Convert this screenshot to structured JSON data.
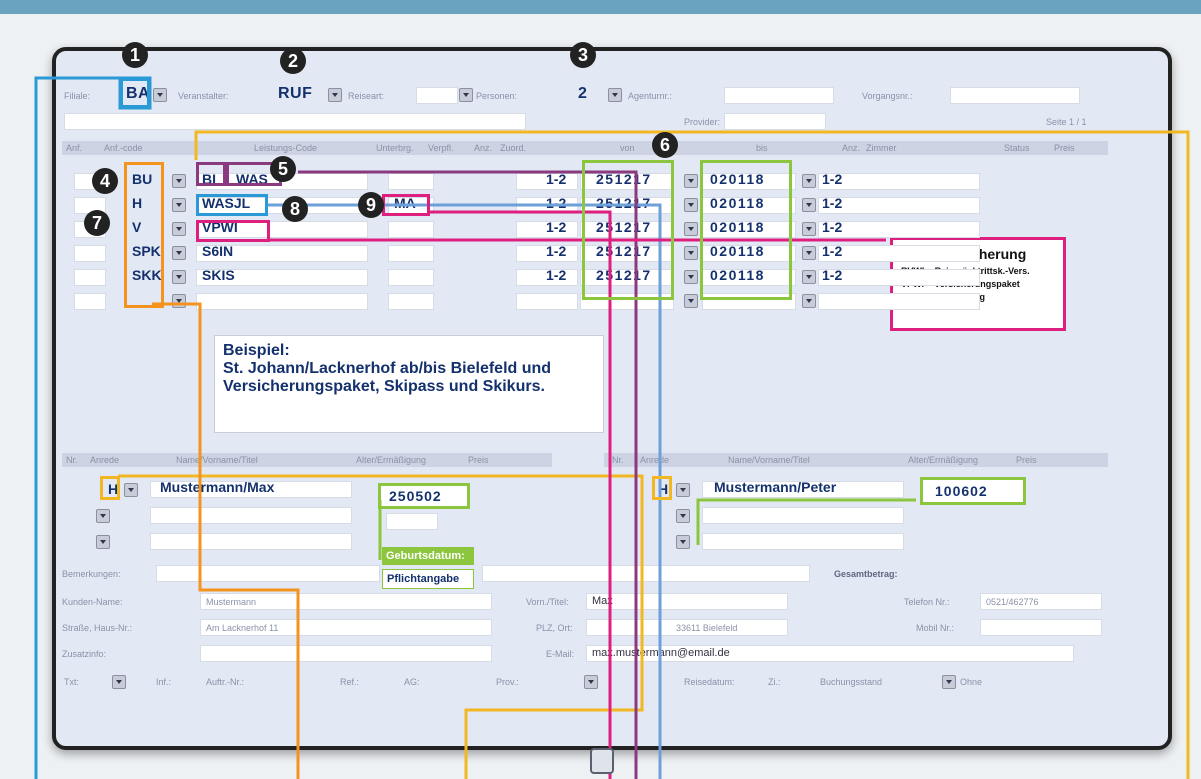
{
  "header": {
    "filiale_label": "Filiale:",
    "filiale_value": "BA",
    "veranstalter_label": "Veranstalter:",
    "veranstalter_value": "RUF",
    "reiseart_label": "Reiseart:",
    "personen_label": "Personen:",
    "personen_value": "2",
    "agentur_label": "Agenturnr.:",
    "vorgangsnr_label": "Vorgangsnr.:",
    "provider_label": "Provider:",
    "seite": "Seite 1 / 1"
  },
  "services_columns": [
    "Anf.",
    "Anf.-code",
    "Leistungs-Code",
    "Unterbrg.",
    "Verpfl.",
    "Anz.",
    "Zuord.",
    "von",
    "bis",
    "Anz.",
    "Zimmer",
    "Status",
    "Preis"
  ],
  "services": [
    {
      "code": "BU",
      "leistung": "BI",
      "leistung2": "WAS",
      "zuord": "1-2",
      "von": "251217",
      "bis": "020118",
      "pers": "1-2"
    },
    {
      "code": "H",
      "leistung": "WASJL",
      "unterbr": "MA",
      "zuord": "1-2",
      "von": "251217",
      "bis": "020118",
      "pers": "1-2"
    },
    {
      "code": "V",
      "leistung": "VPWI",
      "zuord": "1-2",
      "von": "251217",
      "bis": "020118",
      "pers": "1-2"
    },
    {
      "code": "SPK",
      "leistung": "S6IN",
      "zuord": "1-2",
      "von": "251217",
      "bis": "020118",
      "pers": "1-2"
    },
    {
      "code": "SKK",
      "leistung": "SKIS",
      "zuord": "1-2",
      "von": "251217",
      "bis": "020118",
      "pers": "1-2"
    }
  ],
  "markers": [
    "1",
    "2",
    "3",
    "4",
    "5",
    "6",
    "7",
    "8",
    "9"
  ],
  "insurance_note": {
    "title": "Reiseversicherung",
    "line1": "RVWI = Reiserücktrittsk.-Vers.",
    "line2": "VPWI = Versicherungspaket",
    "line3": "ruf.de/versicherung"
  },
  "example_note": {
    "line1": "Beispiel:",
    "line2": "St. Johann/Lacknerhof ab/bis Bielefeld und",
    "line3": "Versicherungspaket, Skipass und Skikurs."
  },
  "travellers_columns": [
    "Nr.",
    "Anrede",
    "Name/Vorname/Titel",
    "Alter/Ermäßigung",
    "Preis"
  ],
  "travellers": [
    {
      "anrede": "H",
      "name": "Mustermann/Max",
      "geburt": "250502"
    },
    {
      "anrede": "H",
      "name": "Mustermann/Peter",
      "geburt": "100602"
    }
  ],
  "birth_note": {
    "title": "Geburtsdatum:",
    "subtitle": "Pflichtangabe"
  },
  "customer": {
    "bemerkungen_label": "Bemerkungen:",
    "gesamt_label": "Gesamtbetrag:",
    "name_label": "Kunden-Name:",
    "name_value": "Mustermann",
    "vorname_label": "Vorn./Titel:",
    "vorname_value": "Max",
    "telefon_label": "Telefon Nr.:",
    "telefon_value": "0521/462776",
    "strasse_label": "Straße, Haus-Nr.:",
    "strasse_value": "Am Lacknerhof 11",
    "plz_label": "PLZ, Ort:",
    "plz_value": "33611 Bielefeld",
    "mobil_label": "Mobil Nr.:",
    "zusatzinfo_label": "Zusatzinfo:",
    "email_label": "E-Mail:",
    "email_value": "max.mustermann@email.de",
    "bottom_labels": [
      "Txt:",
      "Inf.:",
      "Auftr.-Nr.:",
      "Ref.:",
      "AG:",
      "Prov.:",
      "Reisedatum:",
      "Zi.:",
      "Buchungsstand",
      "Ohne"
    ]
  }
}
